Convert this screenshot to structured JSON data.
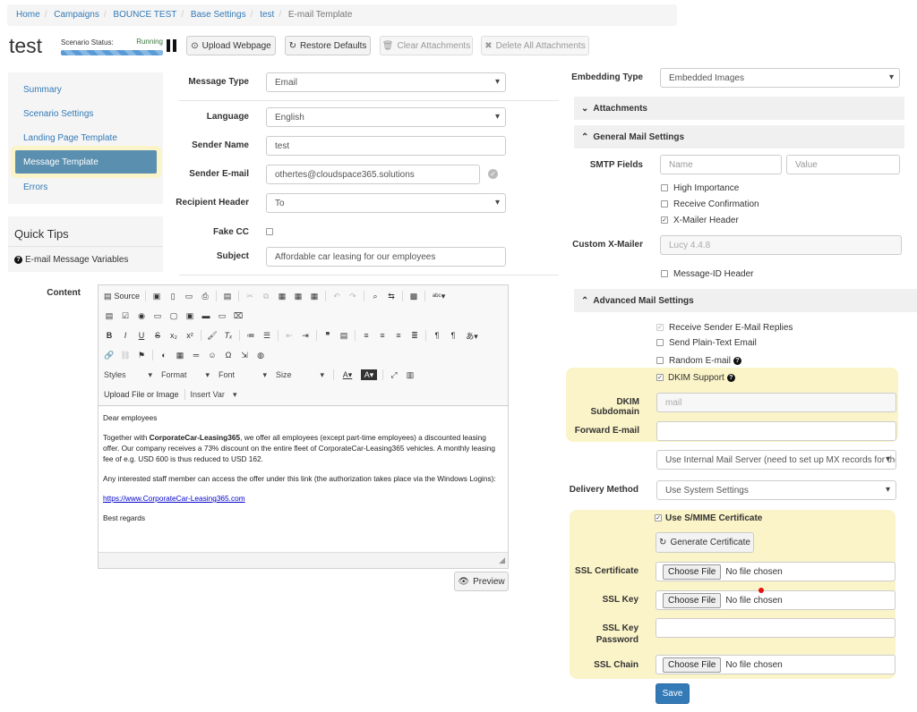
{
  "breadcrumb": {
    "items": [
      "Home",
      "Campaigns",
      "BOUNCE TEST",
      "Base Settings",
      "test"
    ],
    "current": "E-mail Template"
  },
  "header": {
    "title": "test",
    "status_label": "Scenario Status:",
    "status_value": "Running",
    "buttons": {
      "upload": "Upload Webpage",
      "restore": "Restore Defaults",
      "clear": "Clear Attachments",
      "delete": "Delete All Attachments"
    }
  },
  "sidebar": {
    "items": [
      "Summary",
      "Scenario Settings",
      "Landing Page Template",
      "Message Template",
      "Errors"
    ],
    "quick_tips_title": "Quick Tips",
    "quick_tips_link": "E-mail Message Variables"
  },
  "form": {
    "message_type_label": "Message Type",
    "message_type_value": "Email",
    "language_label": "Language",
    "language_value": "English",
    "sender_name_label": "Sender Name",
    "sender_name_value": "test",
    "sender_email_label": "Sender E-mail",
    "sender_email_value": "othertes@cloudspace365.solutions",
    "recipient_header_label": "Recipient Header",
    "recipient_header_value": "To",
    "fake_cc_label": "Fake CC",
    "subject_label": "Subject",
    "subject_value": "Affordable car leasing for our employees",
    "content_label": "Content"
  },
  "editor": {
    "source": "Source",
    "styles": "Styles",
    "format": "Format",
    "font": "Font",
    "size": "Size",
    "upload_file": "Upload File or Image",
    "insert_var": "Insert Var",
    "body": {
      "greeting": "Dear employees",
      "p1_pre": "Together with ",
      "p1_bold": "CorporateCar-Leasing365",
      "p1_post": ", we offer all employees (except part-time employees) a discounted leasing offer. Our company receives a 73% discount on the entire fleet of CorporateCar-Leasing365 vehicles. A monthly leasing fee of e.g. USD 600 is thus reduced to USD 162.",
      "p2": "Any interested staff member can access the offer under this link (the authorization takes place via the Windows Logins):",
      "link": "https://www.CorporateCar-Leasing365.com",
      "closing": "Best regards"
    },
    "preview_button": "Preview"
  },
  "right": {
    "embedding_type_label": "Embedding Type",
    "embedding_type_value": "Embedded Images",
    "attachments_section": "Attachments",
    "general_section": "General Mail Settings",
    "smtp_fields_label": "SMTP Fields",
    "smtp_name_placeholder": "Name",
    "smtp_value_placeholder": "Value",
    "high_importance": "High Importance",
    "receive_confirmation": "Receive Confirmation",
    "x_mailer_header": "X-Mailer Header",
    "custom_x_mailer_label": "Custom X-Mailer",
    "custom_x_mailer_value": "Lucy 4.4.8",
    "message_id_header": "Message-ID Header",
    "advanced_section": "Advanced Mail Settings",
    "receive_sender_replies": "Receive Sender E-Mail Replies",
    "send_plain_text": "Send Plain-Text Email",
    "random_email": "Random E-mail",
    "dkim_support": "DKIM Support",
    "dkim_subdomain_label": "DKIM Subdomain",
    "dkim_subdomain_placeholder": "mail",
    "forward_email_label": "Forward E-mail",
    "mail_server_value": "Use Internal Mail Server (need to set up MX records for the",
    "delivery_method_label": "Delivery Method",
    "delivery_method_value": "Use System Settings",
    "use_smime": "Use S/MIME Certificate",
    "generate_cert": "Generate Certificate",
    "ssl_cert_label": "SSL Certificate",
    "ssl_key_label": "SSL Key",
    "ssl_key_password_label_1": "SSL Key",
    "ssl_key_password_label_2": "Password",
    "ssl_chain_label": "SSL Chain",
    "choose_file": "Choose File",
    "no_file": "No file chosen",
    "save_button": "Save"
  }
}
